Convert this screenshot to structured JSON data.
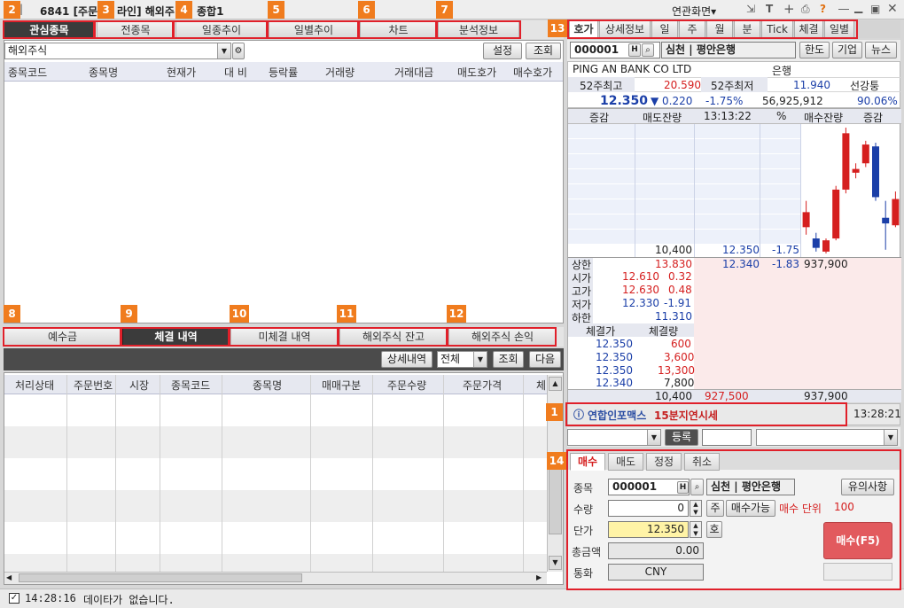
{
  "window": {
    "title": "6841 [주문/온라인] 해외주식 종합1",
    "title_left": "6841 [주문",
    "title_mid": "라인] 해외주",
    "title_right": "종합1",
    "menu_label": "연관화면▾",
    "icons": [
      "screen-link-icon",
      "text-size-icon",
      "add-icon",
      "print-icon",
      "help-icon",
      "minimize-icon",
      "restore-icon",
      "close-icon"
    ]
  },
  "callouts": [
    "1",
    "2",
    "3",
    "4",
    "5",
    "6",
    "7",
    "8",
    "9",
    "10",
    "11",
    "12",
    "13",
    "14"
  ],
  "top_tabs": [
    "관심종목",
    "전종목",
    "일종추이",
    "일별추이",
    "차트",
    "분석정보"
  ],
  "watch": {
    "group_value": "해외주식",
    "settings_btn": "설정",
    "query_btn": "조회",
    "columns": [
      "종목코드",
      "종목명",
      "현재가",
      "대 비",
      "등락률",
      "거래량",
      "거래대금",
      "매도호가",
      "매수호가"
    ]
  },
  "bottom_tabs": [
    "예수금",
    "체결 내역",
    "미체결 내역",
    "해외주식 잔고",
    "해외주식 손익"
  ],
  "exec": {
    "detail_btn": "상세내역",
    "filter_value": "전체",
    "query_btn": "조회",
    "next_btn": "다음",
    "columns": [
      "처리상태",
      "주문번호",
      "시장",
      "종목코드",
      "종목명",
      "매매구분",
      "주문수량",
      "주문가격",
      "체"
    ]
  },
  "right_tabs": [
    "호가",
    "상세정보",
    "일",
    "주",
    "월",
    "분",
    "Tick",
    "체결",
    "일별"
  ],
  "quote": {
    "code": "000001",
    "name": "심천 | 평안은행",
    "btn_limit": "한도",
    "btn_company": "기업",
    "btn_news": "뉴스",
    "eng_name": "PING AN BANK CO LTD",
    "sector": "은행",
    "hi52_label": "52주최고",
    "hi52": "20.590",
    "lo52_label": "52주최저",
    "lo52": "11.940",
    "market": "선강퉁",
    "price": "12.350",
    "change": "▼ 0.220",
    "pct": "-1.75%",
    "volume": "56,925,912",
    "strength": "90.06%",
    "ob_headers": [
      "증감",
      "매도잔량",
      "13:13:22",
      "%",
      "매수잔량",
      "증감"
    ],
    "ask_total_qty": "10,400",
    "ask_price": "12.350",
    "ask_pct": "-1.75",
    "bid_price": "12.340",
    "bid_pct": "-1.83",
    "bid_qty": "937,900",
    "upper_label": "상한",
    "upper": "13.830",
    "open_label": "시가",
    "open": "12.610",
    "open_pct": "0.32",
    "high_label": "고가",
    "high": "12.630",
    "high_pct": "0.48",
    "low_label": "저가",
    "low": "12.330",
    "low_pct": "-1.91",
    "lower_label": "하한",
    "lower": "11.310",
    "trades_headers": [
      "체결가",
      "체결량"
    ],
    "trades": [
      {
        "price": "12.350",
        "qty": "600"
      },
      {
        "price": "12.350",
        "qty": "3,600"
      },
      {
        "price": "12.350",
        "qty": "13,300"
      },
      {
        "price": "12.340",
        "qty": "7,800"
      }
    ],
    "sum_qty": "10,400",
    "sum_ask": "927,500",
    "sum_bid": "937,900",
    "info_brand": "연합인포맥스",
    "info_delay": "15분지연시세",
    "info_time": "13:28:21"
  },
  "mid_bar": {
    "register_btn": "등록"
  },
  "order": {
    "tabs": [
      "매수",
      "매도",
      "정정",
      "취소"
    ],
    "code_label": "종목",
    "code": "000001",
    "name": "심천 | 평안은행",
    "caution_btn": "유의사항",
    "qty_label": "수량",
    "qty": "0",
    "qty_unit": "주",
    "buyable_btn": "매수가능",
    "buy_unit_label": "매수 단위",
    "buy_unit": "100",
    "price_label": "단가",
    "price": "12.350",
    "price_unit": "호",
    "total_label": "총금액",
    "total": "0.00",
    "currency_label": "통화",
    "currency": "CNY",
    "submit_btn": "매수(F5)"
  },
  "status": {
    "time": "14:28:16",
    "message": "데이타가 없습니다."
  },
  "candles": [
    {
      "o": 12.42,
      "c": 12.5,
      "h": 12.56,
      "l": 12.38
    },
    {
      "o": 12.36,
      "c": 12.31,
      "h": 12.39,
      "l": 12.29
    },
    {
      "o": 12.29,
      "c": 12.35,
      "h": 12.36,
      "l": 12.28
    },
    {
      "o": 12.36,
      "c": 12.62,
      "h": 12.64,
      "l": 12.35
    },
    {
      "o": 12.62,
      "c": 12.92,
      "h": 12.95,
      "l": 12.6
    },
    {
      "o": 12.71,
      "c": 12.73,
      "h": 12.76,
      "l": 12.68
    },
    {
      "o": 12.76,
      "c": 12.86,
      "h": 12.88,
      "l": 12.74
    },
    {
      "o": 12.85,
      "c": 12.58,
      "h": 12.87,
      "l": 12.56
    },
    {
      "o": 12.47,
      "c": 12.44,
      "h": 12.56,
      "l": 12.3
    },
    {
      "o": 12.43,
      "c": 12.57,
      "h": 12.61,
      "l": 12.42
    }
  ],
  "colors": {
    "badge": "#f07c1e",
    "callout_border": "#e0202a",
    "rise": "#d51f1f",
    "fall": "#1b3fa8",
    "order_price_bg": "#fff3a6",
    "submit_bg": "#e25a5e"
  }
}
